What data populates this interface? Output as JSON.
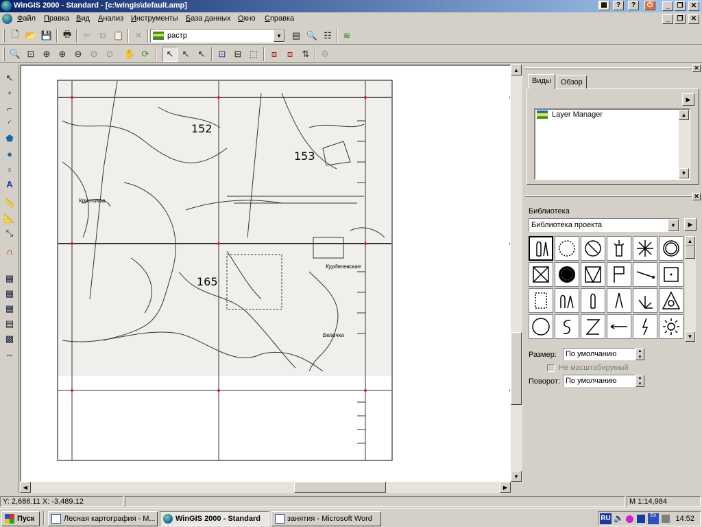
{
  "window": {
    "title": "WinGIS 2000 - Standard - [c:\\wingis\\default.amp]"
  },
  "menu": [
    "Файл",
    "Правка",
    "Вид",
    "Анализ",
    "Инструменты",
    "База данных",
    "Окно",
    "Справка"
  ],
  "toolbar": {
    "layer_combo_value": "растр"
  },
  "map": {
    "labels": [
      "152",
      "153",
      "165"
    ],
    "handwritten": [
      "Кругликов",
      "Курделевская",
      "Беличка"
    ]
  },
  "views_panel": {
    "tabs": [
      "Виды",
      "Обзор"
    ],
    "active_tab": "Виды",
    "tree_items": [
      "Layer Manager"
    ]
  },
  "library_panel": {
    "title": "Библиотека",
    "selected_library": "Библиотека проекта",
    "size_label": "Размер:",
    "size_value": "По умолчанию",
    "not_scalable_label": "Не масштабирумый",
    "rotation_label": "Поворот:",
    "rotation_value": "По умолчанию",
    "symbols": [
      "tree-icon",
      "circle-dotted-icon",
      "no-entry-icon",
      "candle-icon",
      "sun-burst-icon",
      "circle-ring-icon",
      "square-x-icon",
      "dark-dot-icon",
      "triangle-box-icon",
      "flag-icon",
      "line-dot-icon",
      "square-dot-icon",
      "dotted-rect-icon",
      "tree-pair-icon",
      "single-tree-icon",
      "conifer-icon",
      "grass-icon",
      "triangle-circle-icon",
      "circle-icon",
      "s-curve-icon",
      "z-icon",
      "arrow-left-icon",
      "lightning-icon",
      "sun-icon"
    ]
  },
  "status": {
    "coords": "Y: 2,686.11 X: -3,489.12",
    "scale": "M 1:14,984"
  },
  "taskbar": {
    "start": "Пуск",
    "tasks": [
      "Лесная картография - M...",
      "WinGIS 2000 - Standard",
      "занятия - Microsoft Word"
    ],
    "active_task": "WinGIS 2000 - Standard",
    "tray_lang": "RU",
    "clock": "14:52"
  },
  "colors": {
    "title_start": "#0a246a",
    "title_end": "#a6caf0",
    "face": "#d4d0c8",
    "control_point": "#e02020"
  }
}
